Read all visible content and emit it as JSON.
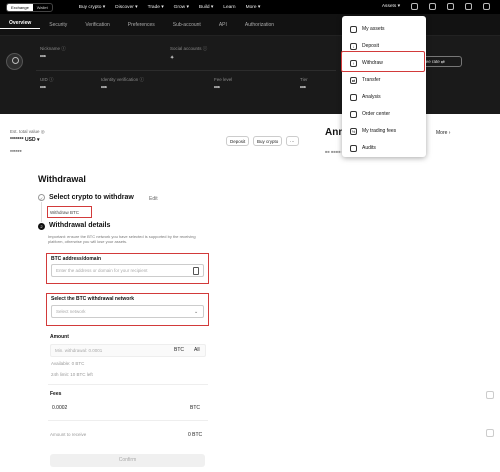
{
  "topbar": {
    "segments": [
      "Exchange",
      "Wallet"
    ],
    "menu": [
      "Buy crypto ▾",
      "Discover ▾",
      "Trade ▾",
      "Grow ▾",
      "Build ▾",
      "Learn",
      "More ▾"
    ],
    "assets_label": "Assets ▾"
  },
  "tabs": [
    "Overview",
    "Security",
    "Verification",
    "Preferences",
    "Sub-account",
    "API",
    "Authorization"
  ],
  "hero": {
    "nickname_label": "Nickname ⓘ",
    "social_label": "Social accounts ⓘ",
    "uid_label": "UID ⓘ",
    "verify_label": "Identity verification ⓘ",
    "fee_label": "Fee level",
    "tier_label": "Tier",
    "masked": "***",
    "button_label": "Fee rate ⇄"
  },
  "account": {
    "label": "Est. total value ◎",
    "value": "******* USD ▾",
    "sub": "******",
    "pills": [
      "Deposit",
      "Buy crypto",
      "⋯"
    ],
    "announcement": "Ann",
    "more": "More ›"
  },
  "withdraw": {
    "title": "Withdrawal",
    "step1_title": "Select crypto to withdraw",
    "step1_edit": "Edit",
    "step1_value": "Withdraw BTC",
    "step2_title": "Withdrawal details",
    "hint": "Important: ensure the BTC network you have selected is supported by the receiving platform, otherwise you will lose your assets.",
    "address_label": "BTC address/domain",
    "address_placeholder": "Enter the address or domain for your recipient",
    "network_label": "Select the BTC withdrawal network",
    "network_placeholder": "Select network",
    "amount_label": "Amount",
    "amount_placeholder": "Min. withdrawal: 0.0001",
    "amount_unit": "BTC",
    "amount_all": "All",
    "available": "Available: 0 BTC",
    "limit": "24h limit: 10 BTC left",
    "fees_label": "Fees",
    "fees_value": "0.0002",
    "fees_unit": "BTC",
    "receive_label": "Amount to receive",
    "receive_value": "0 BTC",
    "confirm": "Confirm"
  },
  "dropdown": {
    "items": [
      {
        "icon": "assets-icon",
        "label": "My assets"
      },
      {
        "icon": "deposit-icon",
        "label": "Deposit"
      },
      {
        "icon": "withdraw-icon",
        "label": "Withdraw"
      },
      {
        "icon": "transfer-icon",
        "label": "Transfer"
      },
      {
        "icon": "analysis-icon",
        "label": "Analysis"
      },
      {
        "icon": "order-icon",
        "label": "Order center"
      },
      {
        "icon": "trading-fee-icon",
        "label": "My trading fees"
      },
      {
        "icon": "audits-icon",
        "label": "Audits"
      }
    ]
  },
  "colors": {
    "highlight": "#d23a3a",
    "dark": "#1a1a1a"
  }
}
